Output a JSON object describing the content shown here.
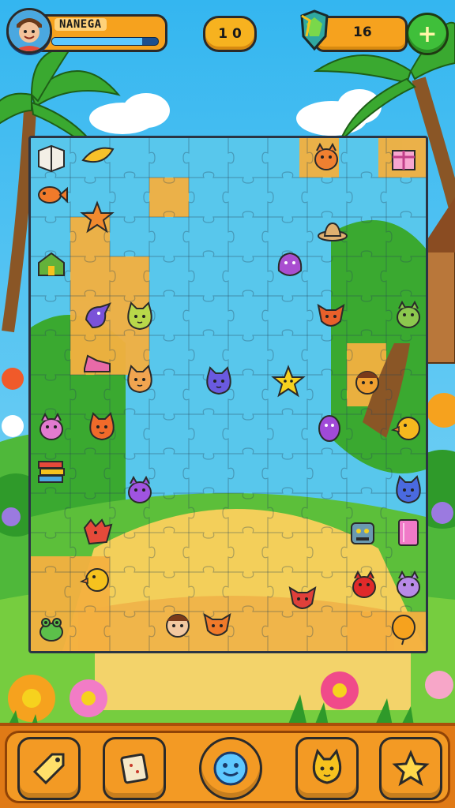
{
  "player": {
    "name": "NANEGA",
    "xp_fraction": 0.85
  },
  "hud": {
    "level": "1 0",
    "gems": "16",
    "add_label": "+"
  },
  "board": {
    "columns": 10,
    "rows": 13,
    "pieces": [
      {
        "name": "piece-book",
        "icon": "book-icon",
        "color": "#f3efe6"
      },
      {
        "name": "piece-banana-leaf",
        "icon": "leaf-icon",
        "color": "#f6c12a"
      },
      {
        "name": "piece-orange-creature",
        "icon": "creature-icon",
        "color": "#f08030"
      },
      {
        "name": "piece-gift-box",
        "icon": "gift-icon",
        "color": "#f7a6d0"
      },
      {
        "name": "piece-orange-fish",
        "icon": "fish-icon",
        "color": "#f07a2a"
      },
      {
        "name": "piece-starfish",
        "icon": "starfish-icon",
        "color": "#f28a2e"
      },
      {
        "name": "piece-hat",
        "icon": "hat-icon",
        "color": "#e0b070"
      },
      {
        "name": "piece-green-house",
        "icon": "house-icon",
        "color": "#63b23a"
      },
      {
        "name": "piece-purple-blob",
        "icon": "blob-icon",
        "color": "#a94ed0"
      },
      {
        "name": "piece-purple-bird",
        "icon": "bird-icon",
        "color": "#7a52d8"
      },
      {
        "name": "piece-green-cat",
        "icon": "cat-icon",
        "color": "#b8d84a"
      },
      {
        "name": "piece-fox",
        "icon": "fox-icon",
        "color": "#e7602b"
      },
      {
        "name": "piece-green-creature",
        "icon": "creature-icon",
        "color": "#8cc84e"
      },
      {
        "name": "piece-pink-shoe",
        "icon": "shoe-icon",
        "color": "#e86aa8"
      },
      {
        "name": "piece-cat-face",
        "icon": "cat-icon",
        "color": "#f0a450"
      },
      {
        "name": "piece-purple-cat",
        "icon": "cat-icon",
        "color": "#6a5ae0"
      },
      {
        "name": "piece-yellow-star",
        "icon": "star-icon",
        "color": "#f6d21e"
      },
      {
        "name": "piece-red-hat-face",
        "icon": "face-icon",
        "color": "#f0a030"
      },
      {
        "name": "piece-pink-creature",
        "icon": "creature-icon",
        "color": "#e27bd0"
      },
      {
        "name": "piece-orange-cat",
        "icon": "cat-icon",
        "color": "#f06a2a"
      },
      {
        "name": "piece-purple-egg",
        "icon": "egg-icon",
        "color": "#a04ad8"
      },
      {
        "name": "piece-yellow-chick",
        "icon": "chick-icon",
        "color": "#f6b81e"
      },
      {
        "name": "piece-red-books",
        "icon": "books-icon",
        "color": "#e54a3a"
      },
      {
        "name": "piece-violet-creature",
        "icon": "creature-icon",
        "color": "#a054e0"
      },
      {
        "name": "piece-blue-cat",
        "icon": "cat-icon",
        "color": "#4a6ae0"
      },
      {
        "name": "piece-red-dragon",
        "icon": "dragon-icon",
        "color": "#e54a3a"
      },
      {
        "name": "piece-robot",
        "icon": "robot-icon",
        "color": "#6a9ab0"
      },
      {
        "name": "piece-pink-gem",
        "icon": "gem-icon",
        "color": "#f07ac8"
      },
      {
        "name": "piece-yellow-bird",
        "icon": "chick-icon",
        "color": "#f6c21e"
      },
      {
        "name": "piece-small-fox",
        "icon": "fox-icon",
        "color": "#e0403a"
      },
      {
        "name": "piece-red-creature",
        "icon": "creature-icon",
        "color": "#e02a2a"
      },
      {
        "name": "piece-lilac-creature",
        "icon": "creature-icon",
        "color": "#b88ae8"
      },
      {
        "name": "piece-green-frog",
        "icon": "frog-icon",
        "color": "#5cc04a"
      },
      {
        "name": "piece-boy-face",
        "icon": "face-icon",
        "color": "#f2c8a0"
      },
      {
        "name": "piece-orange-fox",
        "icon": "fox-icon",
        "color": "#f07a2a"
      },
      {
        "name": "piece-orange-balloon",
        "icon": "balloon-icon",
        "color": "#f6a21e"
      }
    ]
  },
  "toolbar": {
    "items": [
      {
        "name": "hint-tool-button",
        "icon": "tag-icon",
        "bg": "#f6c21e"
      },
      {
        "name": "shuffle-tool-button",
        "icon": "card-icon",
        "bg": "#e0302a"
      },
      {
        "name": "face-tool-button",
        "icon": "smiley-icon",
        "bg": "#2a8ae0"
      },
      {
        "name": "pet-tool-button",
        "icon": "cat-icon",
        "bg": "#3fbf3a"
      },
      {
        "name": "favorite-tool-button",
        "icon": "star-icon",
        "bg": "#f6b21e"
      }
    ]
  }
}
